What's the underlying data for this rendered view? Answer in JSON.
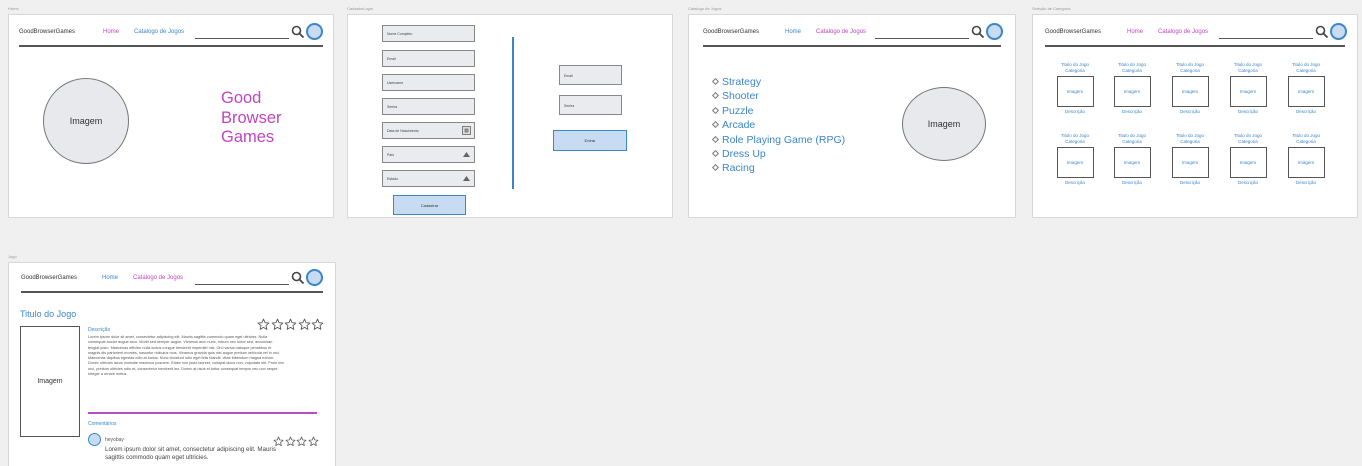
{
  "colors": {
    "accent_blue": "#3b86c9",
    "accent_purple": "#c045c0",
    "gray": "#777777"
  },
  "header": {
    "logo": "GoodBrowserGames",
    "nav_home": "Home",
    "nav_catalog": "Catalogo de Jogos",
    "search_icon": "search-icon",
    "avatar_icon": "user-avatar-icon"
  },
  "boards": {
    "home": {
      "label": "Home",
      "image_label": "Imagem",
      "brand_lines": [
        "Good",
        "Browser",
        "Games"
      ]
    },
    "cadastro": {
      "label": "CadastroLogin",
      "fields": [
        "Nome Completo",
        "Email",
        "Username",
        "Senha",
        "Data de Nascimento",
        "País",
        "Estado"
      ],
      "submit": "Cadastrar",
      "login_fields": [
        "Email",
        "Senha"
      ],
      "login_button": "Entrar"
    },
    "catalogo": {
      "label": "Catalogo de Jogos",
      "categories": [
        "Strategy",
        "Shooter",
        "Puzzle",
        "Arcade",
        "Role Playing Game (RPG)",
        "Dress Up",
        "Racing"
      ],
      "image_label": "Imagem"
    },
    "selecao": {
      "label": "Seleção de Categoria",
      "rows": [
        [
          {
            "title": "Titulo do Jogo\nCategoria",
            "image": "Imagem",
            "desc": "Descrição"
          },
          {
            "title": "Titulo do Jogo\nCategoria",
            "image": "Imagem",
            "desc": "Descrição"
          },
          {
            "title": "Titulo do Jogo\nCategoria",
            "image": "Imagem",
            "desc": "Descrição"
          },
          {
            "title": "Titulo do Jogo\nCategoria",
            "image": "Imagem",
            "desc": "Descrição"
          },
          {
            "title": "Titulo do Jogo\nCategoria",
            "image": "Imagem",
            "desc": "Descrição"
          }
        ],
        [
          {
            "title": "Titulo do Jogo\nCategoria",
            "image": "Imagem",
            "desc": "Descrição"
          },
          {
            "title": "Titulo do Jogo\nCategoria",
            "image": "Imagem",
            "desc": "Descrição"
          },
          {
            "title": "Titulo do Jogo\nCategoria",
            "image": "Imagem",
            "desc": "Descrição"
          },
          {
            "title": "Titulo do Jogo\nCategoria",
            "image": "Imagem",
            "desc": "Descrição"
          },
          {
            "title": "Titulo do Jogo\nCategoria",
            "image": "Imagem",
            "desc": "Descrição"
          }
        ]
      ]
    },
    "jogo": {
      "label": "Jogo",
      "title": "Titulo do Jogo",
      "image_label": "Imagem",
      "rating_stars": 5,
      "description_label": "Descrição",
      "description": "Lorem ipsum dolor sit amet, consectetur adipiscing elit. Mauris sagittis commodo quam eget ultricies. Nulla consequat auctor augue arcu. Morbi sed semper augue. Vivamus arcu nunc, rutrum nec tortor sed, accumsan feugiat justo. Maecenas efficitur nulla luctus congue hendrerit imperdiet nisl. Orci varius natoque penatibus et magnis dis parturient montes, nascetur ridiculus mus. Vivamus gravida quis nisl augue pretium vehicula vel in orci. Maecenas dapibus egestas odio at luctus. Nunc tincidunt odio eget felis blandit, vitae bibendum magna rutrum. Donec ultricies lacus molestie maximus posuere. Etiam non justo laoreet, volutpat lacus non, vulputate elit. Proin nisl orci, pretium ultricies odio et, consectetur hendrerit leo. Donec at risus et tortor consequat tempor nec non neque. Integer a ornare metus.",
      "comments_label": "Comentários",
      "comment_user": "heyobay",
      "comment_text": "Lorem ipsum dolor sit amet, consectetur adipiscing elit. Mauris sagittis commodo quam eget ultricies.",
      "comment_stars": 4
    }
  }
}
